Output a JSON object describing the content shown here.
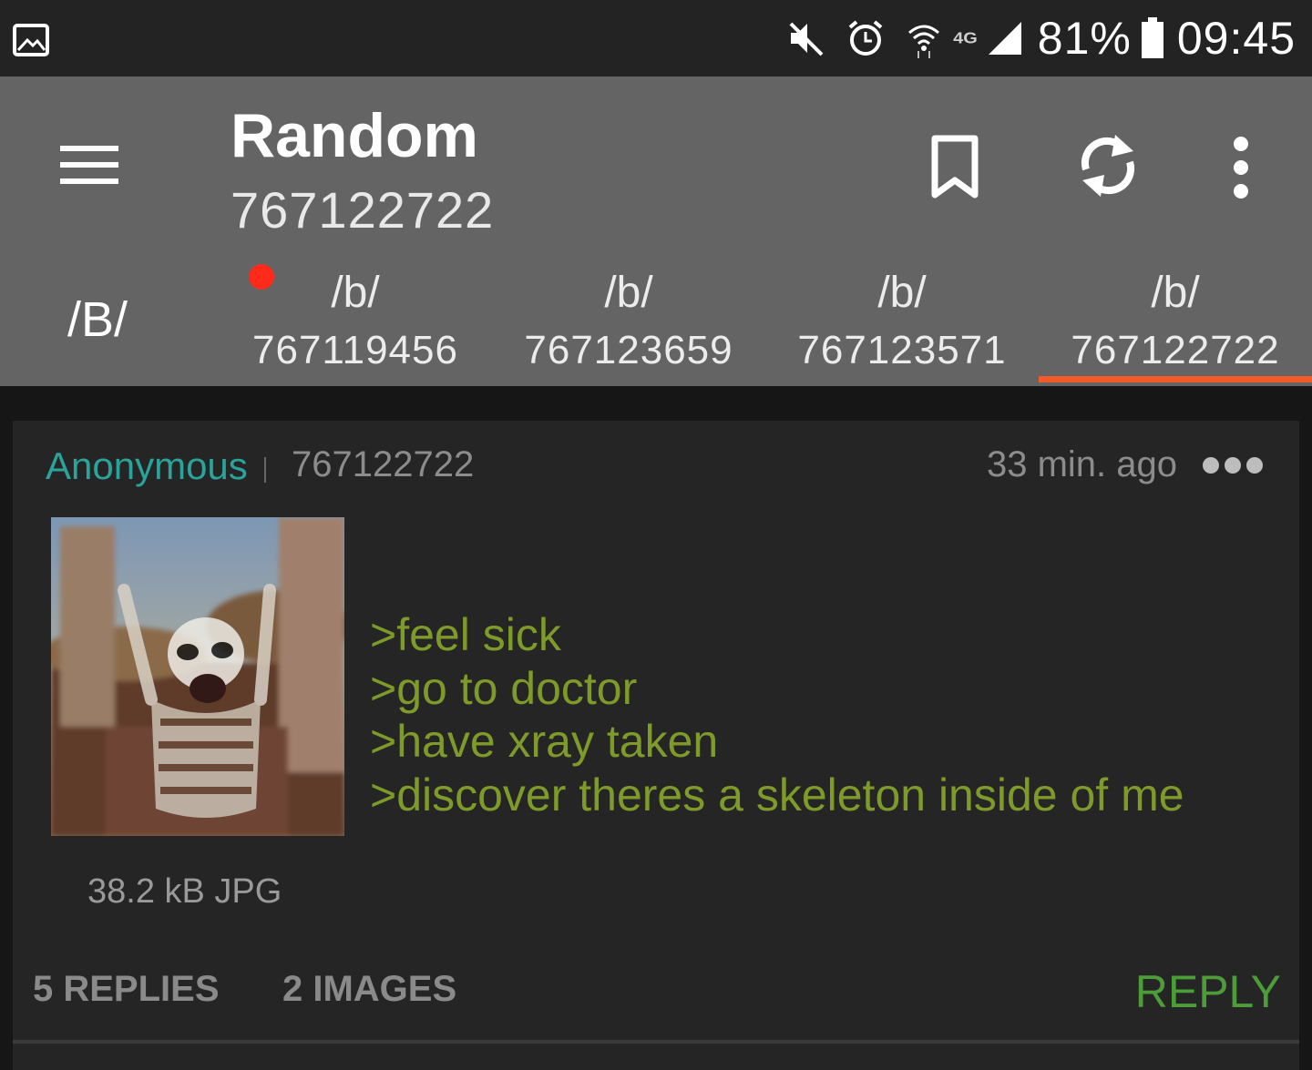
{
  "status_bar": {
    "network": "4G",
    "battery": "81%",
    "time": "09:45",
    "icons": [
      "gallery-icon",
      "mute-icon",
      "alarm-icon",
      "wifi-icon",
      "signal-icon",
      "battery-icon"
    ]
  },
  "toolbar": {
    "title": "Random",
    "subtitle": "767122722",
    "icons": [
      "menu-icon",
      "bookmark-icon",
      "refresh-icon",
      "more-vert-icon"
    ]
  },
  "tabs": {
    "board_label": "/B/",
    "items": [
      {
        "board": "/b/",
        "thread": "767119456",
        "unread": true
      },
      {
        "board": "/b/",
        "thread": "767123659"
      },
      {
        "board": "/b/",
        "thread": "767123571"
      },
      {
        "board": "/b/",
        "thread": "767122722",
        "active": true
      }
    ]
  },
  "post": {
    "name": "Anonymous",
    "number": "767122722",
    "time_ago": "33 min. ago",
    "lines": [
      ">feel sick",
      ">go to doctor",
      ">have xray taken",
      ">discover theres a skeleton inside of me"
    ],
    "file_info": "38.2 kB JPG",
    "replies": "5 REPLIES",
    "images": "2 IMAGES",
    "reply_label": "REPLY"
  },
  "colors": {
    "toolbar": "#646464",
    "accent": "#f25a2a",
    "name": "#2aa39a",
    "greentext": "#7e9b2a",
    "reply": "#4c9c38"
  }
}
